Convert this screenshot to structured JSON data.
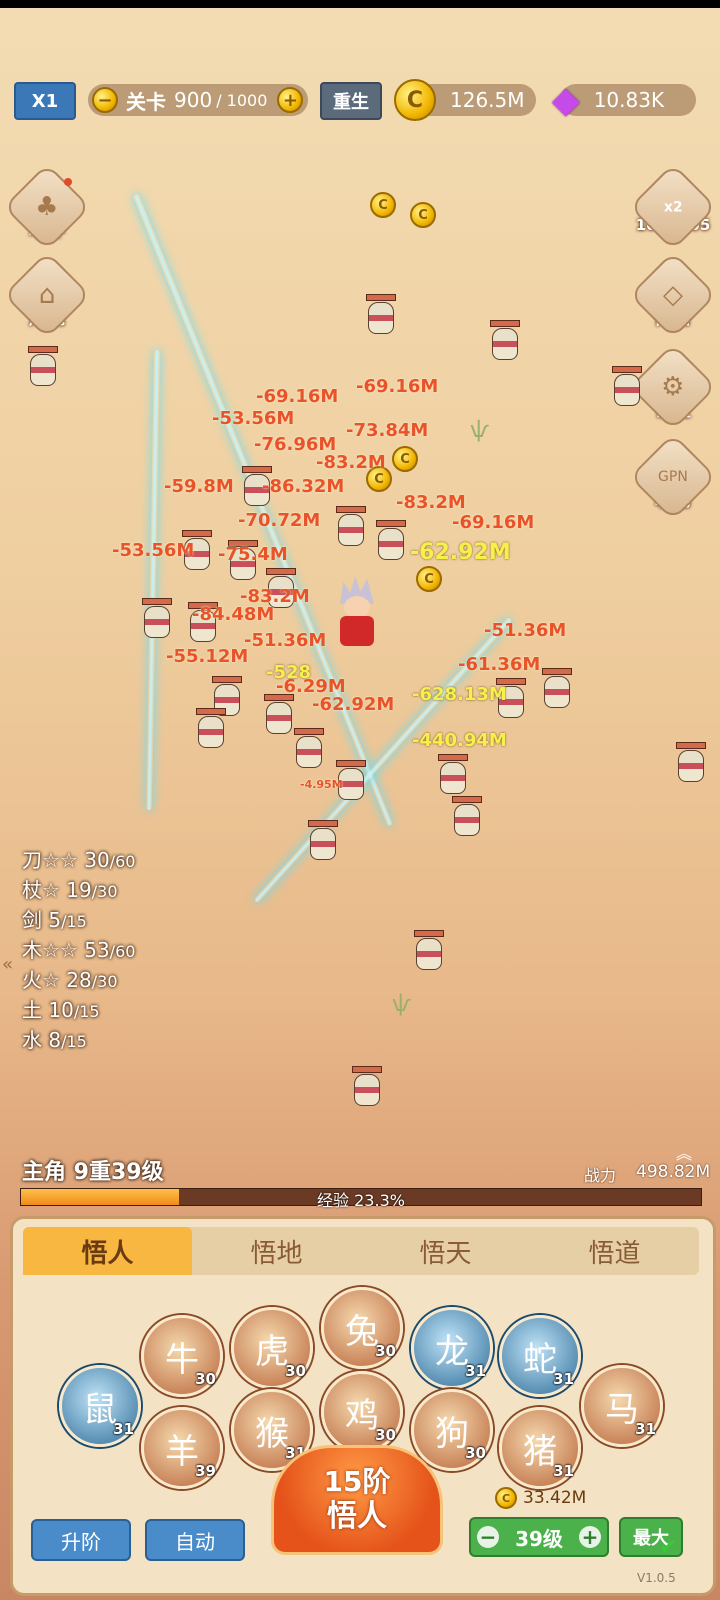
{
  "topbar": {
    "speed": "X1",
    "stage_label": "关卡",
    "stage_current": "900",
    "stage_total": "/ 1000",
    "rebirth": "重生",
    "gold": "126.5M",
    "gems": "10.83K"
  },
  "left_menu": [
    {
      "label": "培养",
      "icon": "cultivate-icon"
    },
    {
      "label": "炼魂",
      "icon": "soul-refine-icon"
    }
  ],
  "right_menu": {
    "boost_label": "x2",
    "boost_timer": "10:59:05",
    "items": [
      {
        "label": "商店",
        "icon": "shop-icon"
      },
      {
        "label": "设置",
        "icon": "settings-icon"
      },
      {
        "label": "联动",
        "icon": "link-icon"
      }
    ]
  },
  "damage_numbers": [
    "-69.16M",
    "-69.16M",
    "-53.56M",
    "-76.96M",
    "-73.84M",
    "-83.2M",
    "-59.8M",
    "-86.32M",
    "-83.2M",
    "-70.72M",
    "-69.16M",
    "-53.56M",
    "-75.4M",
    "-83.2M",
    "-84.48M",
    "-51.36M",
    "-55.12M",
    "-6.29M",
    "-62.92M",
    "-61.36M",
    "-51.36M",
    "-4.95M"
  ],
  "crit_numbers": [
    "-62.92M",
    "-628.13M",
    "-440.94M",
    "-528"
  ],
  "weapon_stats": [
    {
      "name": "刀☆☆",
      "value": "30",
      "max": "/60"
    },
    {
      "name": "杖☆",
      "value": "19",
      "max": "/30"
    },
    {
      "name": "剑",
      "value": "5",
      "max": "/15"
    },
    {
      "name": "木☆☆",
      "value": "53",
      "max": "/60"
    },
    {
      "name": "火☆",
      "value": "28",
      "max": "/30"
    },
    {
      "name": "土",
      "value": "10",
      "max": "/15"
    },
    {
      "name": "水",
      "value": "8",
      "max": "/15"
    }
  ],
  "hero": {
    "name_level": "主角 9重39级",
    "power_label": "战力",
    "power": "498.82M",
    "exp_text": "经验 23.3%",
    "exp_percent": 23.3
  },
  "tabs": [
    "悟人",
    "悟地",
    "悟天",
    "悟道"
  ],
  "zodiac": [
    {
      "name": "rat",
      "glyph": "鼠",
      "level": "31",
      "blue": true
    },
    {
      "name": "ox",
      "glyph": "牛",
      "level": "30",
      "blue": false
    },
    {
      "name": "tiger",
      "glyph": "虎",
      "level": "30",
      "blue": false
    },
    {
      "name": "rabbit",
      "glyph": "兔",
      "level": "30",
      "blue": false
    },
    {
      "name": "dragon",
      "glyph": "龙",
      "level": "31",
      "blue": true
    },
    {
      "name": "snake",
      "glyph": "蛇",
      "level": "31",
      "blue": true
    },
    {
      "name": "horse",
      "glyph": "马",
      "level": "31",
      "blue": false
    },
    {
      "name": "goat",
      "glyph": "羊",
      "level": "39",
      "blue": false
    },
    {
      "name": "monkey",
      "glyph": "猴",
      "level": "31",
      "blue": false
    },
    {
      "name": "rooster",
      "glyph": "鸡",
      "level": "30",
      "blue": false
    },
    {
      "name": "dog",
      "glyph": "狗",
      "level": "30",
      "blue": false
    },
    {
      "name": "pig",
      "glyph": "猪",
      "level": "31",
      "blue": false
    }
  ],
  "bottom": {
    "upgrade": "升阶",
    "auto": "自动",
    "main_line1": "15阶",
    "main_line2": "悟人",
    "cost": "33.42M",
    "level": "39级",
    "max": "最大",
    "version": "V1.0.5"
  }
}
